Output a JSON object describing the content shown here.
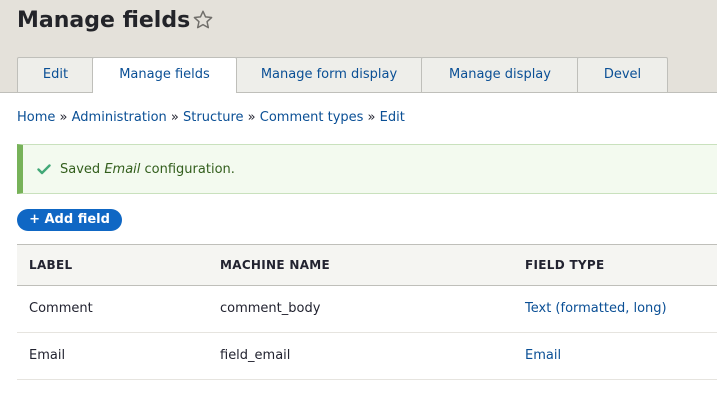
{
  "page": {
    "title": "Manage fields",
    "tabs": [
      {
        "label": "Edit",
        "active": false
      },
      {
        "label": "Manage fields",
        "active": true
      },
      {
        "label": "Manage form display",
        "active": false
      },
      {
        "label": "Manage display",
        "active": false
      },
      {
        "label": "Devel",
        "active": false
      }
    ]
  },
  "breadcrumb": {
    "separator": "»",
    "items": [
      "Home",
      "Administration",
      "Structure",
      "Comment types",
      "Edit"
    ]
  },
  "message": {
    "prefix": "Saved",
    "field": "Email",
    "suffix": "configuration."
  },
  "actions": {
    "add_field_label": "+ Add field"
  },
  "table": {
    "headers": [
      "LABEL",
      "MACHINE NAME",
      "FIELD TYPE"
    ],
    "rows": [
      {
        "label": "Comment",
        "machine_name": "comment_body",
        "field_type": "Text (formatted, long)"
      },
      {
        "label": "Email",
        "machine_name": "field_email",
        "field_type": "Email"
      }
    ]
  },
  "colors": {
    "link": "#0a4f95",
    "button": "#0f67c4",
    "status": "#77b259"
  },
  "icons": {
    "favorite": "star-outline-icon",
    "status": "check-icon"
  }
}
